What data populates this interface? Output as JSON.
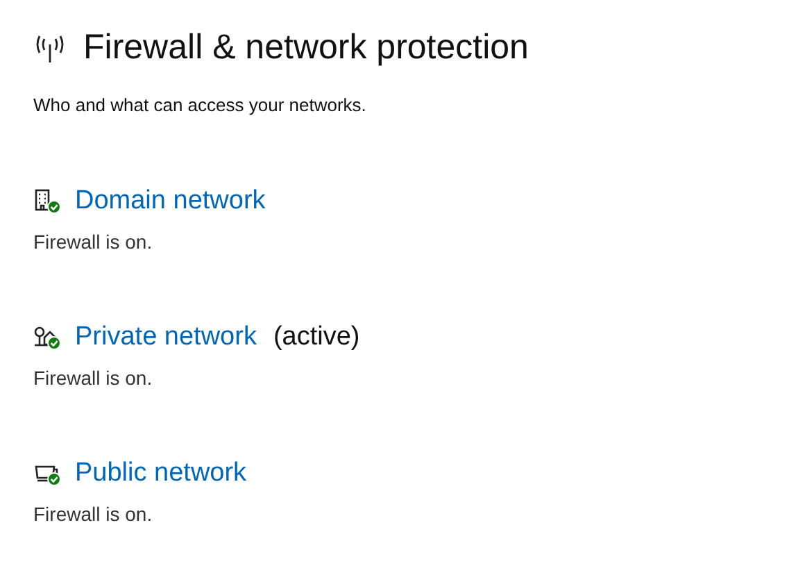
{
  "page": {
    "title": "Firewall & network protection",
    "subtitle": "Who and what can access your networks."
  },
  "networks": [
    {
      "kind": "domain",
      "name": "Domain network",
      "firewall_on": true,
      "status": "Firewall is on."
    },
    {
      "kind": "private",
      "name": "Private network",
      "active_label": "(active)",
      "firewall_on": true,
      "status": "Firewall is on."
    },
    {
      "kind": "public",
      "name": "Public network",
      "firewall_on": true,
      "status": "Firewall is on."
    }
  ]
}
